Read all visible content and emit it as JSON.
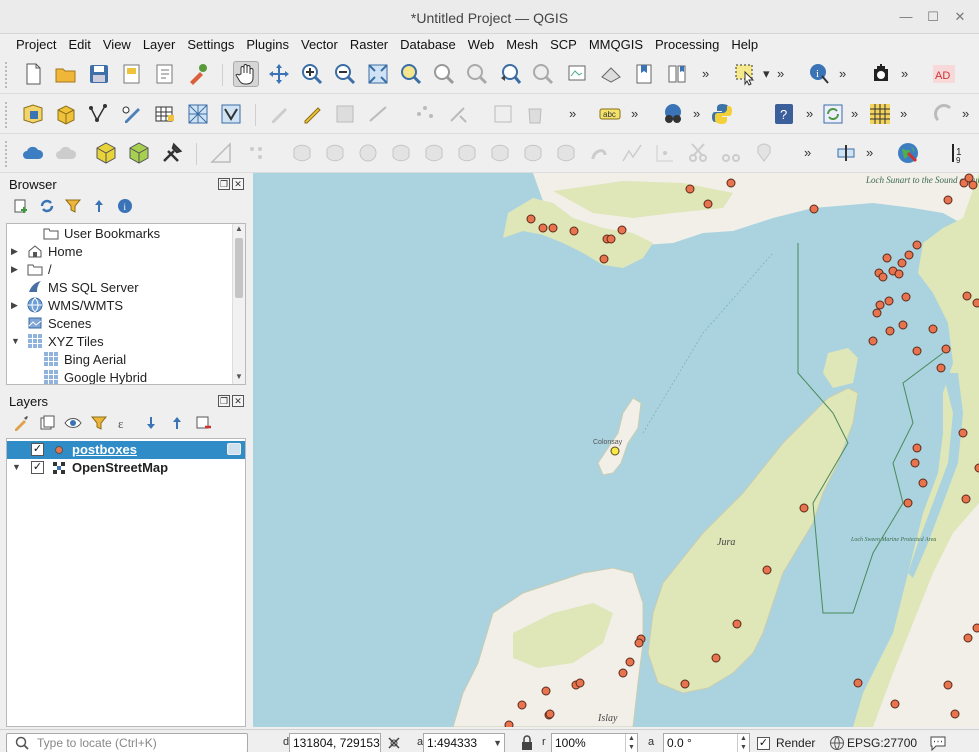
{
  "window": {
    "title": "*Untitled Project — QGIS"
  },
  "menubar": {
    "items": [
      "Project",
      "Edit",
      "View",
      "Layer",
      "Settings",
      "Plugins",
      "Vector",
      "Raster",
      "Database",
      "Web",
      "Mesh",
      "SCP",
      "MMQGIS",
      "Processing",
      "Help"
    ]
  },
  "browser": {
    "title": "Browser",
    "items": [
      {
        "label": "User Bookmarks",
        "icon": "folder-icon",
        "expander": ""
      },
      {
        "label": "Home",
        "icon": "home-folder-icon",
        "expander": "▶"
      },
      {
        "label": "/",
        "icon": "folder-icon",
        "expander": "▶"
      },
      {
        "label": "MS SQL Server",
        "icon": "mssql-icon",
        "expander": ""
      },
      {
        "label": "WMS/WMTS",
        "icon": "globe-icon",
        "expander": "▶"
      },
      {
        "label": "Scenes",
        "icon": "scenes-icon",
        "expander": ""
      },
      {
        "label": "XYZ Tiles",
        "icon": "grid-icon",
        "expander": "▼"
      },
      {
        "label": "Bing Aerial",
        "icon": "grid-icon",
        "expander": ""
      },
      {
        "label": "Google Hybrid",
        "icon": "grid-icon",
        "expander": ""
      }
    ]
  },
  "layers": {
    "title": "Layers",
    "items": [
      {
        "label": "postboxes",
        "checked": "✓",
        "selected": true
      },
      {
        "label": "OpenStreetMap",
        "checked": "✓",
        "selected": false
      }
    ]
  },
  "map": {
    "labels": {
      "loch_sunart": "Loch Sunart to the Sound of Jura Marine Protected Area",
      "jura": "Jura",
      "islay": "Islay",
      "colonsay": "Colonsay",
      "mpa2": "Loch Sween Marine Protected Area"
    },
    "colors": {
      "sea": "#aad3df",
      "land": "#f2efe9",
      "park": "#dfe6b8",
      "postbox": "#e8734f",
      "selected_postbox": "#f7e94a"
    }
  },
  "statusbar": {
    "locate_placeholder": "Type to locate (Ctrl+K)",
    "coord_label": "d",
    "coordinate": "131804, 729153",
    "scale_label": "a",
    "scale": "1:494333",
    "mag_label": "r",
    "magnifier": "100%",
    "rot_label": "a",
    "rotation": "0.0 °",
    "render_label": "Render",
    "render_checked": "✓",
    "crs": "EPSG:27700"
  }
}
